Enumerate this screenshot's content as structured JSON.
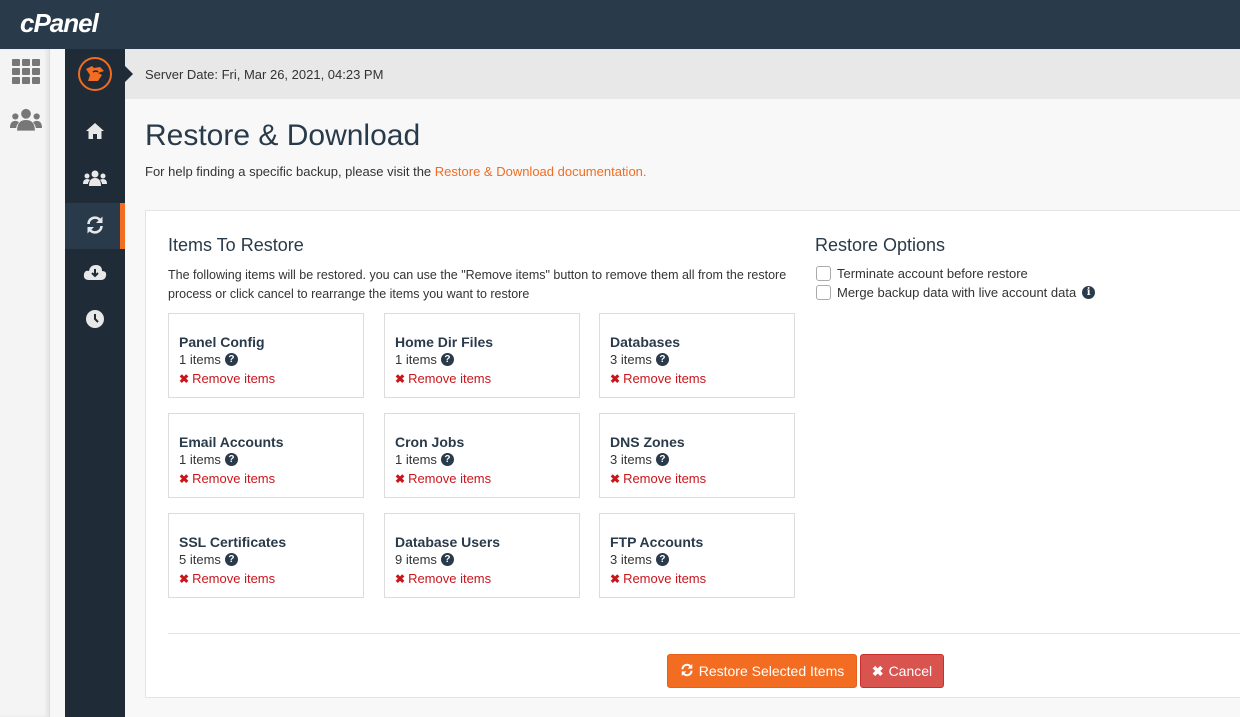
{
  "app": {
    "brand": "cPanel",
    "colors": {
      "accent": "#f26c22",
      "danger": "#d9534f",
      "header": "#293a4a",
      "sidebar": "#1f2b37",
      "remove": "#c9161d"
    }
  },
  "left_rail": {
    "items": [
      {
        "icon": "grid-icon",
        "label": "Tools"
      },
      {
        "icon": "users-icon",
        "label": "Users"
      }
    ]
  },
  "plugin_sidebar": {
    "logo_icon": "plugin-logo-icon",
    "items": [
      {
        "icon": "home-icon",
        "active": false
      },
      {
        "icon": "users-icon",
        "active": false
      },
      {
        "icon": "sync-icon",
        "active": true
      },
      {
        "icon": "cloud-download-icon",
        "active": false
      },
      {
        "icon": "clock-icon",
        "active": false
      }
    ]
  },
  "header": {
    "server_date": "Server Date: Fri, Mar 26, 2021, 04:23 PM"
  },
  "page": {
    "title": "Restore & Download",
    "help_prefix": "For help finding a specific backup, please visit the ",
    "help_link": "Restore & Download documentation."
  },
  "items_section": {
    "title": "Items To Restore",
    "description": "The following items will be restored. you can use the \"Remove items\" button to remove them all from the restore process or click cancel to rearrange the items you want to restore",
    "remove_label": "Remove items",
    "cards": [
      {
        "title": "Panel Config",
        "count": "1 items"
      },
      {
        "title": "Home Dir Files",
        "count": "1 items"
      },
      {
        "title": "Databases",
        "count": "3 items"
      },
      {
        "title": "Email Accounts",
        "count": "1 items"
      },
      {
        "title": "Cron Jobs",
        "count": "1 items"
      },
      {
        "title": "DNS Zones",
        "count": "3 items"
      },
      {
        "title": "SSL Certificates",
        "count": "5 items"
      },
      {
        "title": "Database Users",
        "count": "9 items"
      },
      {
        "title": "FTP Accounts",
        "count": "3 items"
      }
    ]
  },
  "options_section": {
    "title": "Restore Options",
    "options": [
      {
        "label": "Terminate account before restore",
        "checked": false,
        "has_info": false
      },
      {
        "label": "Merge backup data with live account data",
        "checked": false,
        "has_info": true
      }
    ]
  },
  "actions": {
    "restore_label": "Restore Selected Items",
    "cancel_label": "Cancel"
  }
}
